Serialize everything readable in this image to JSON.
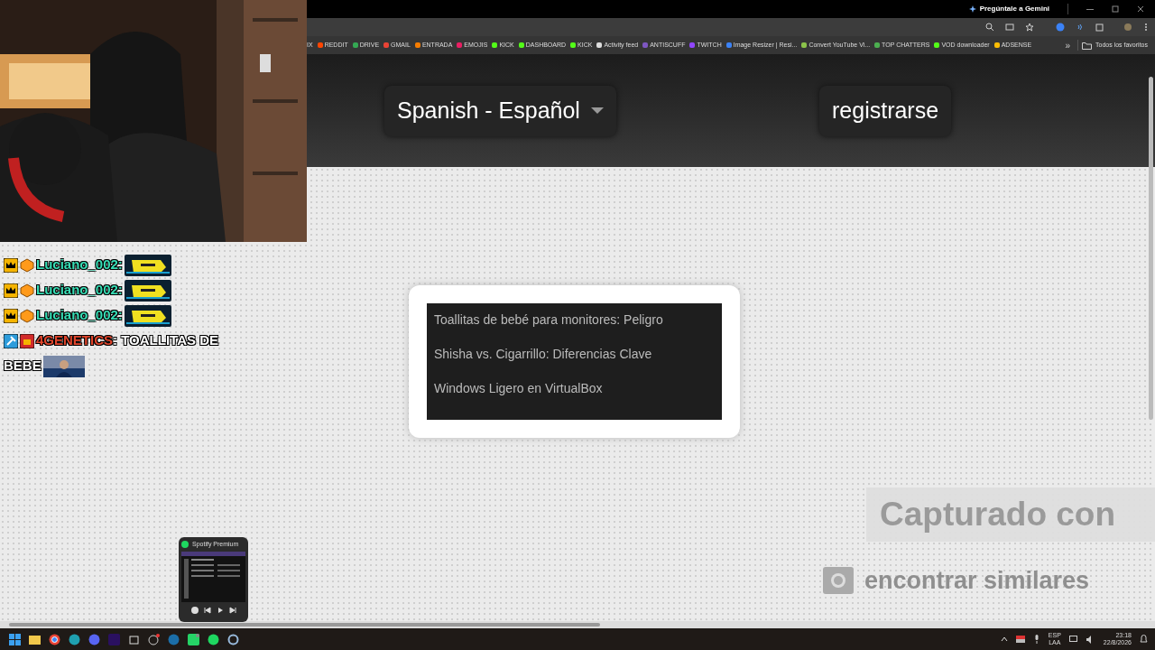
{
  "title_bar": {
    "gemini_button": "Pregúntale a Gemini"
  },
  "bookmarks": [
    {
      "label": "IX"
    },
    {
      "label": "REDDIT",
      "color": "#ff4500"
    },
    {
      "label": "DRIVE",
      "color": "#34a853"
    },
    {
      "label": "GMAIL",
      "color": "#ea4335"
    },
    {
      "label": "ENTRADA",
      "color": "#f57c00"
    },
    {
      "label": "EMOJIS",
      "color": "#e91e63"
    },
    {
      "label": "KICK",
      "color": "#53fc18"
    },
    {
      "label": "DASHBOARD",
      "color": "#53fc18"
    },
    {
      "label": "KICK",
      "color": "#53fc18"
    },
    {
      "label": "Activity feed",
      "color": "#dddddd"
    },
    {
      "label": "ANTISCUFF",
      "color": "#7e57c2"
    },
    {
      "label": "TWITCH",
      "color": "#9146ff"
    },
    {
      "label": "Image Resizer | Resi...",
      "color": "#3b82f6"
    },
    {
      "label": "Convert YouTube Vi...",
      "color": "#8bc34a"
    },
    {
      "label": "TOP CHATTERS",
      "color": "#4caf50"
    },
    {
      "label": "VOD downloader",
      "color": "#53fc18"
    },
    {
      "label": "ADSENSE",
      "color": "#fbbc04"
    }
  ],
  "more_bookmarks": "»",
  "all_bookmarks": "Todos los favoritos",
  "header": {
    "language_select": "Spanish - Español",
    "register_button": "registrarse"
  },
  "recent_list": [
    "Toallitas de bebé para monitores: Peligro",
    "Shisha vs. Cigarrillo: Diferencias Clave",
    "Windows Ligero en VirtualBox"
  ],
  "capture_overlay": {
    "title": "Capturado con",
    "similar": "encontrar similares"
  },
  "chat": [
    {
      "kind": "emote",
      "username": "Luciano_002:",
      "color": "#37dcb4"
    },
    {
      "kind": "emote",
      "username": "Luciano_002:",
      "color": "#37dcb4"
    },
    {
      "kind": "emote",
      "username": "Luciano_002:",
      "color": "#37dcb4"
    },
    {
      "kind": "text",
      "username": "4GENETICS",
      "color": "#e2452c",
      "text_lines": [
        ": TOALLITAS DE",
        "BEBE"
      ]
    }
  ],
  "spotify_preview": {
    "title": "Spotify Premium"
  },
  "tray": {
    "language": "ESP",
    "layout": "LAA",
    "time": "23:18",
    "date": "22/8/2026"
  }
}
